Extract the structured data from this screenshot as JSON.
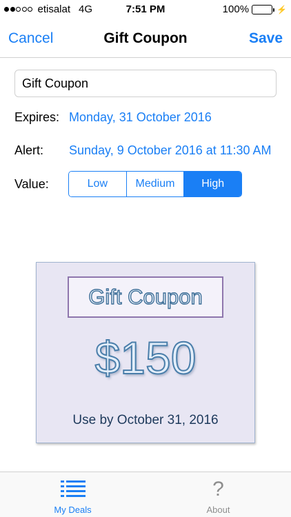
{
  "status_bar": {
    "carrier": "etisalat",
    "network": "4G",
    "time": "7:51 PM",
    "battery": "100%",
    "signal_bars_filled": 2,
    "signal_bars_total": 5
  },
  "nav": {
    "cancel_label": "Cancel",
    "title": "Gift Coupon",
    "save_label": "Save"
  },
  "form": {
    "name_value": "Gift Coupon",
    "expires_label": "Expires:",
    "expires_value": "Monday, 31 October 2016",
    "alert_label": "Alert:",
    "alert_value": "Sunday, 9 October 2016 at 11:30 AM",
    "value_label": "Value:",
    "value_options": [
      "Low",
      "Medium",
      "High"
    ],
    "value_selected": "High"
  },
  "coupon": {
    "title": "Gift Coupon",
    "amount": "$150",
    "use_by": "Use by October 31, 2016"
  },
  "tab_bar": {
    "my_deals_label": "My Deals",
    "about_label": "About"
  },
  "colors": {
    "accent": "#1a7ff5",
    "battery": "#4cd964",
    "coupon_bg": "#e8e6f3"
  },
  "icons": {
    "my_deals": "list-icon",
    "about": "question-mark-icon",
    "charging": "bolt-icon"
  }
}
